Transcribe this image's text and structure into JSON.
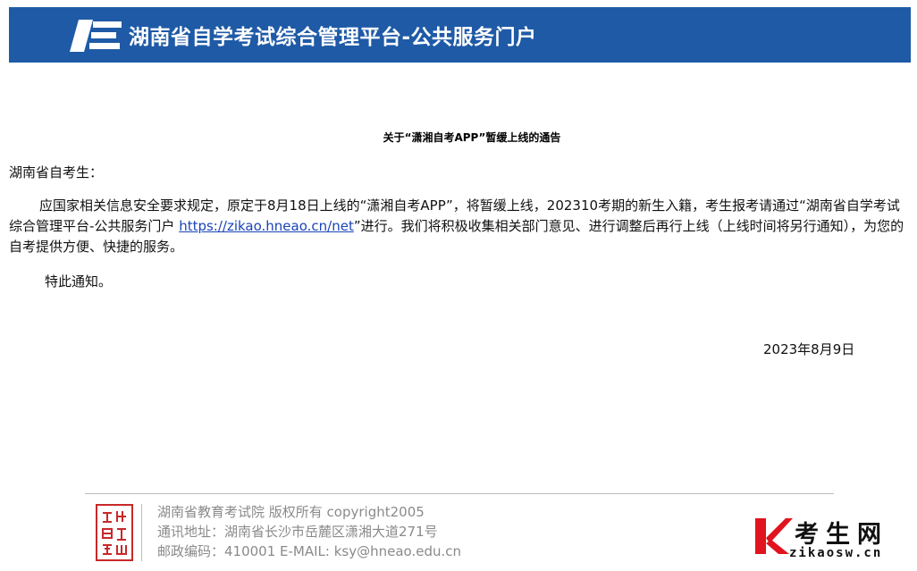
{
  "header": {
    "logo_icon": "exam-portal-logo-icon",
    "title": "湖南省自学考试综合管理平台-公共服务门户",
    "background_color": "#1f5aa6"
  },
  "notice": {
    "title": "关于“潇湘自考APP”暂缓上线的通告",
    "salutation": "湖南省自考生：",
    "paragraph_before_link": "应国家相关信息安全要求规定，原定于8月18日上线的“潇湘自考APP”，将暂缓上线，202310考期的新生入籍，考生报考请通过“湖南省自学考试综合管理平台-公共服务门户 ",
    "link_text": "https://zikao.hneao.cn/net",
    "paragraph_after_link": "”进行。我们将积极收集相关部门意见、进行调整后再行上线（上线时间将另行通知），为您的自考提供方便、快捷的服务。",
    "closing": "特此通知。",
    "date": "2023年8月9日"
  },
  "footer": {
    "seal_icon": "red-seal-icon",
    "copyright": "湖南省教育考试院 版权所有 copyright2005",
    "address": "通讯地址：湖南省长沙市岳麓区潇湘大道271号",
    "contact": "邮政编码：410001 E-MAIL: ksy@hneao.edu.cn"
  },
  "watermark": {
    "logo_icon": "k-logo-icon",
    "name": "考生网",
    "url": "zikaosw.cn",
    "accent_color": "#e0141e"
  }
}
